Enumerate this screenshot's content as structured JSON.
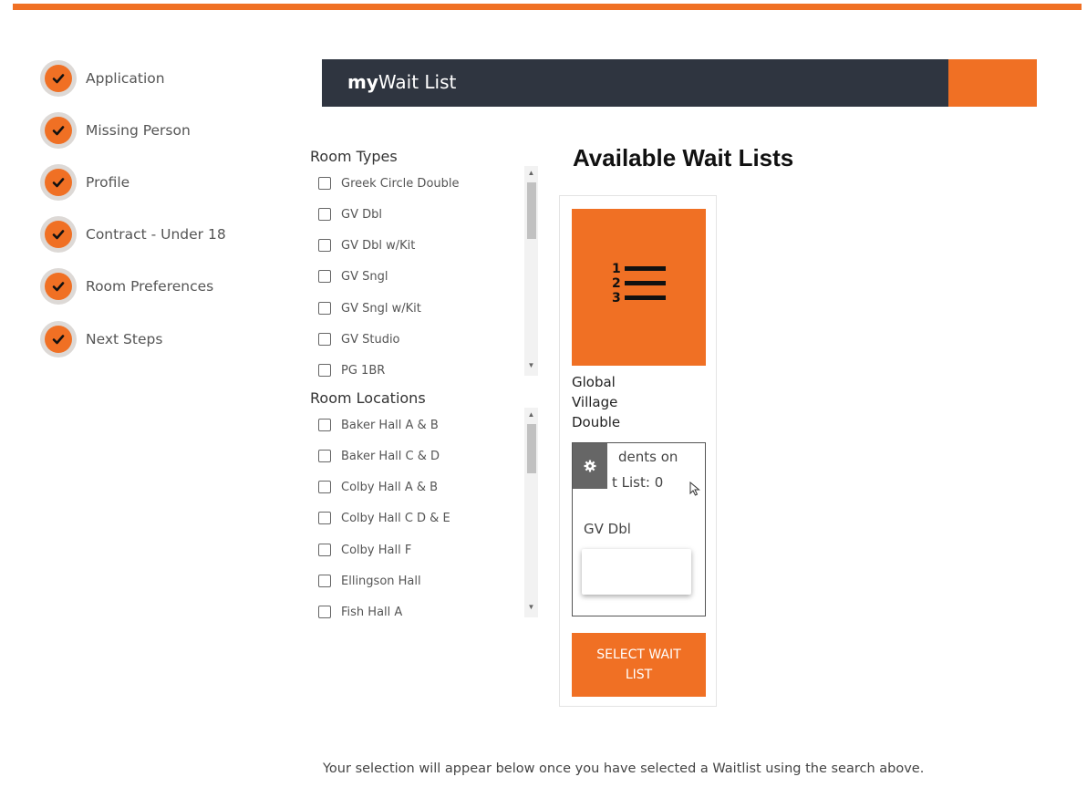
{
  "steps": [
    {
      "label": "Application",
      "status_icon": "checkmark-icon"
    },
    {
      "label": "Missing Person",
      "status_icon": "checkmark-icon"
    },
    {
      "label": "Profile",
      "status_icon": "checkmark-icon"
    },
    {
      "label": "Contract - Under 18",
      "status_icon": "checkmark-icon"
    },
    {
      "label": "Room Preferences",
      "status_icon": "checkmark-icon"
    },
    {
      "label": "Next Steps",
      "status_icon": "checkmark-icon"
    }
  ],
  "header": {
    "title_bold": "my",
    "title_rest": "Wait List"
  },
  "room_types": {
    "title": "Room Types",
    "items": [
      "Greek Circle Double",
      "GV Dbl",
      "GV Dbl w/Kit",
      "GV Sngl",
      "GV Sngl w/Kit",
      "GV Studio",
      "PG 1BR"
    ]
  },
  "room_locations": {
    "title": "Room Locations",
    "items": [
      "Baker Hall A & B",
      "Baker Hall C & D",
      "Colby Hall A & B",
      "Colby Hall C D & E",
      "Colby Hall F",
      "Ellingson Hall",
      "Fish Hall A"
    ]
  },
  "available": {
    "title": "Available Wait Lists",
    "card": {
      "name_lines": [
        "Global",
        "Village",
        "Double"
      ],
      "icon": "numbered-list-icon",
      "detail_line1": "dents on",
      "detail_line2": "t List: 0",
      "detail_line3": "GV Dbl",
      "button_line1": "SELECT WAIT",
      "button_line2": "LIST"
    }
  },
  "footer_note": "Your selection will appear below once you have selected a Waitlist using the search above.",
  "colors": {
    "accent": "#f07024",
    "header_bg": "#2f3540"
  }
}
